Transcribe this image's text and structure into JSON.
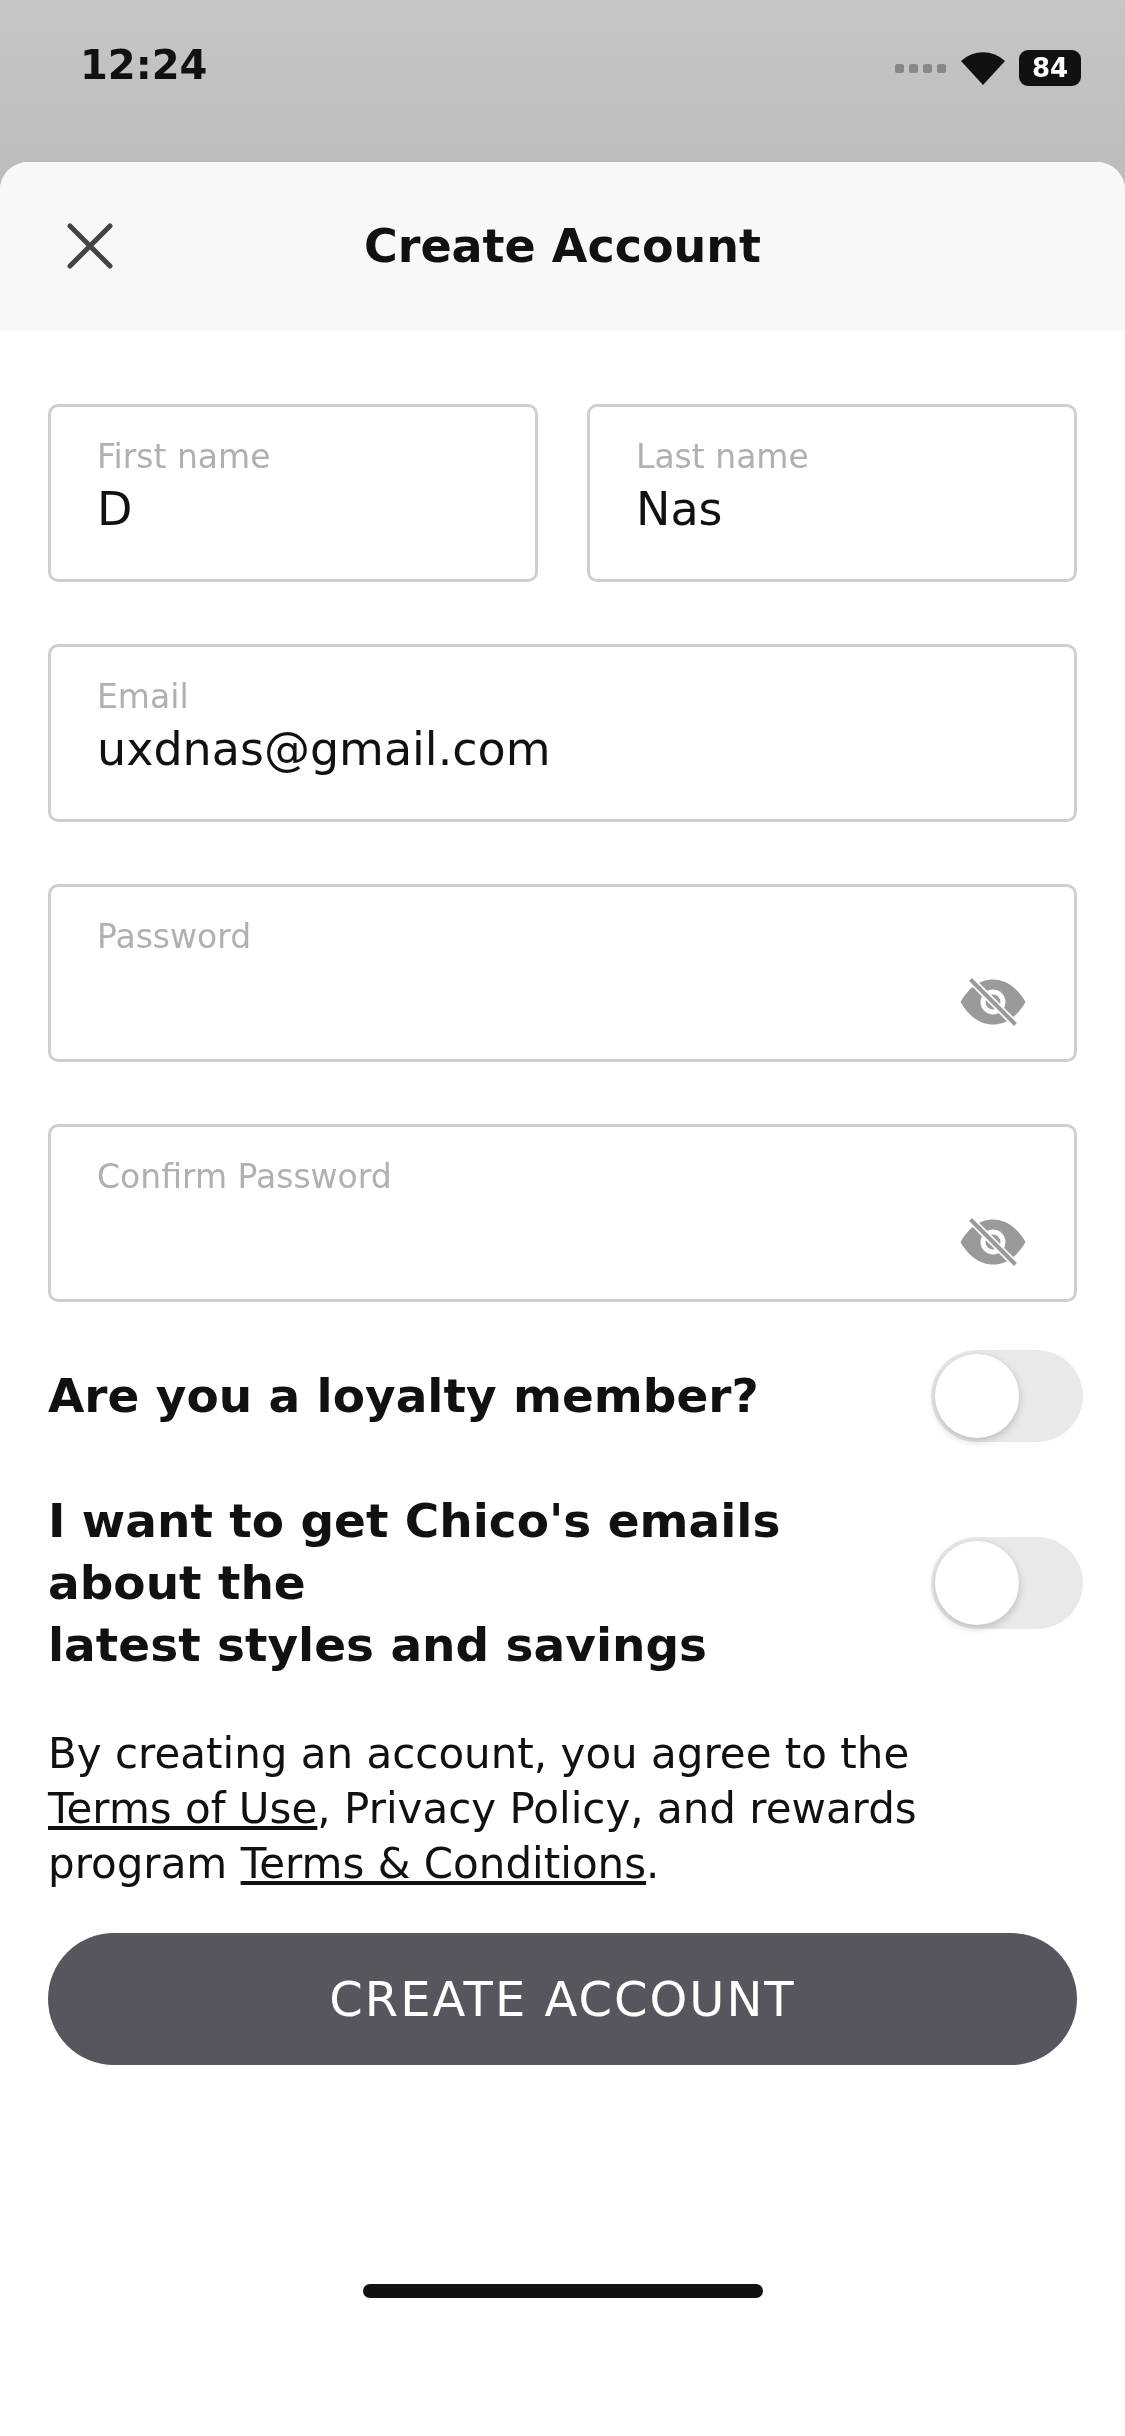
{
  "status_bar": {
    "time": "12:24",
    "battery": "84"
  },
  "header": {
    "title": "Create Account"
  },
  "field_rows": [
    [
      {
        "kind": "text",
        "label": "First name",
        "value": "D"
      },
      {
        "kind": "text",
        "label": "Last name",
        "value": "Nas"
      }
    ],
    [
      {
        "kind": "text",
        "label": "Email",
        "value": "uxdnas@gmail.com"
      }
    ],
    [
      {
        "kind": "password",
        "label": "Password"
      }
    ],
    [
      {
        "kind": "password",
        "label": "Confirm Password"
      }
    ]
  ],
  "toggles": [
    {
      "label": "Are you a loyalty member?",
      "on": false
    },
    {
      "label": "I want to get Chico's emails about the\nlatest styles and savings",
      "on": false
    }
  ],
  "legal": [
    {
      "kind": "text",
      "text": "By creating an account, you agree to the "
    },
    {
      "kind": "link",
      "text": "Terms of Use"
    },
    {
      "kind": "text",
      "text": ", Privacy Policy, and rewards program "
    },
    {
      "kind": "link",
      "text": "Terms & Conditions"
    },
    {
      "kind": "text",
      "text": "."
    }
  ],
  "submit": {
    "label": "CREATE ACCOUNT"
  }
}
